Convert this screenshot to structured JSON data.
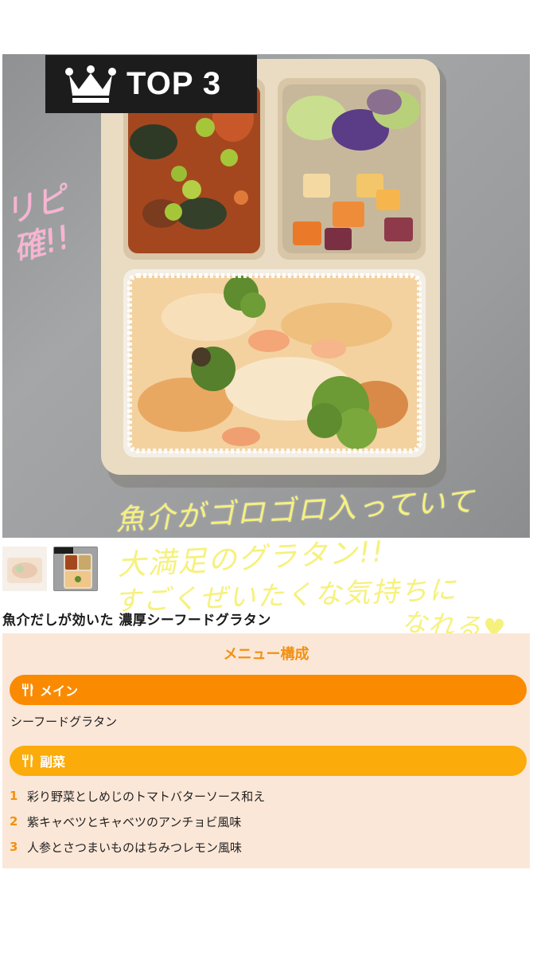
{
  "badge": {
    "label": "TOP 3"
  },
  "handwriting": {
    "pink": "リピ確!!",
    "line1": "魚介がゴロゴロ入っていて",
    "line2": "大満足のグラタン!!",
    "line3": "すごくぜいたくな気持ちに",
    "line4": "なれる♥"
  },
  "product": {
    "title": "魚介だしが効いた 濃厚シーフードグラタン"
  },
  "menu": {
    "heading": "メニュー構成",
    "main": {
      "label": "メイン",
      "item": "シーフードグラタン"
    },
    "side": {
      "label": "副菜",
      "items": [
        {
          "num": "1",
          "text": "彩り野菜としめじのトマトバターソース和え"
        },
        {
          "num": "2",
          "text": "紫キャベツとキャベツのアンチョビ風味"
        },
        {
          "num": "3",
          "text": "人参とさつまいものはちみつレモン風味"
        }
      ]
    }
  },
  "icons": {
    "crown": "crown-icon",
    "fork": "fork-knife-icon"
  },
  "colors": {
    "accent_orange": "#fa8a00",
    "side_orange": "#fbab0a",
    "heading": "#f39011",
    "menu_bg": "#fbe7d8"
  }
}
